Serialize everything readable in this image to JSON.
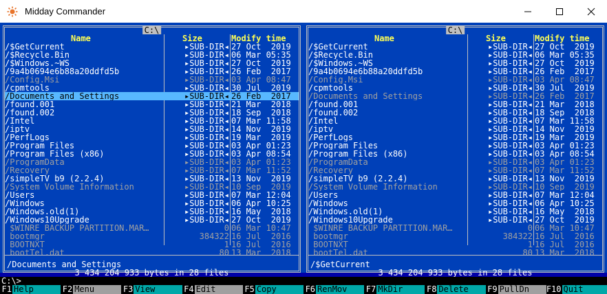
{
  "window": {
    "title": "Midday Commander"
  },
  "headers": {
    "name": "Name",
    "size": "Size",
    "modify": "Modify time"
  },
  "left": {
    "path": "C:\\",
    "selected_index": 5,
    "footer_name": "/Documents and Settings",
    "total": "3 434 204 933 bytes in 28 files",
    "entries": [
      {
        "name": "/$GetCurrent",
        "size": "▸SUB-DIR◂",
        "date": "27 Oct  2019",
        "type": "dir"
      },
      {
        "name": "/$Recycle.Bin",
        "size": "▸SUB-DIR◂",
        "date": "06 Mar 05:35",
        "type": "dir"
      },
      {
        "name": "/$Windows.~WS",
        "size": "▸SUB-DIR◂",
        "date": "27 Oct  2019",
        "type": "dir"
      },
      {
        "name": "/9a4b0694e6b88a20ddfd5b",
        "size": "▸SUB-DIR◂",
        "date": "26 Feb  2017",
        "type": "dir"
      },
      {
        "name": "/Config.Msi",
        "size": "▸SUB-DIR◂",
        "date": "03 Apr 08:47",
        "type": "hidden"
      },
      {
        "name": "/cpmtools",
        "size": "▸SUB-DIR◂",
        "date": "30 Jul  2019",
        "type": "dir"
      },
      {
        "name": "/Documents and Settings",
        "size": "▸SUB-DIR◂",
        "date": "26 Feb  2017",
        "type": "dir"
      },
      {
        "name": "/found.001",
        "size": "▸SUB-DIR◂",
        "date": "21 Mar  2018",
        "type": "dir"
      },
      {
        "name": "/found.002",
        "size": "▸SUB-DIR◂",
        "date": "18 Sep  2018",
        "type": "dir"
      },
      {
        "name": "/Intel",
        "size": "▸SUB-DIR◂",
        "date": "07 Mar 11:58",
        "type": "dir"
      },
      {
        "name": "/iptv",
        "size": "▸SUB-DIR◂",
        "date": "14 Nov  2019",
        "type": "dir"
      },
      {
        "name": "/PerfLogs",
        "size": "▸SUB-DIR◂",
        "date": "19 Mar  2019",
        "type": "dir"
      },
      {
        "name": "/Program Files",
        "size": "▸SUB-DIR◂",
        "date": "03 Apr 01:23",
        "type": "dir"
      },
      {
        "name": "/Program Files (x86)",
        "size": "▸SUB-DIR◂",
        "date": "03 Apr 08:54",
        "type": "dir"
      },
      {
        "name": "/ProgramData",
        "size": "▸SUB-DIR◂",
        "date": "03 Apr 01:23",
        "type": "hidden"
      },
      {
        "name": "/Recovery",
        "size": "▸SUB-DIR◂",
        "date": "07 Mar 11:52",
        "type": "hidden"
      },
      {
        "name": "/simpleTV b9 (2.2.4)",
        "size": "▸SUB-DIR◂",
        "date": "13 Nov  2019",
        "type": "dir"
      },
      {
        "name": "/System Volume Information",
        "size": "▸SUB-DIR◂",
        "date": "10 Sep  2019",
        "type": "hidden"
      },
      {
        "name": "/Users",
        "size": "▸SUB-DIR◂",
        "date": "07 Mar 12:04",
        "type": "dir"
      },
      {
        "name": "/Windows",
        "size": "▸SUB-DIR◂",
        "date": "06 Apr 10:25",
        "type": "dir"
      },
      {
        "name": "/Windows.old(1)",
        "size": "▸SUB-DIR◂",
        "date": "16 May  2018",
        "type": "dir"
      },
      {
        "name": "/Windows10Upgrade",
        "size": "▸SUB-DIR◂",
        "date": "27 Oct  2019",
        "type": "dir"
      },
      {
        "name": " $WINRE_BACKUP_PARTITION.MAR…",
        "size": "0",
        "date": "06 Mar 10:47",
        "type": "file"
      },
      {
        "name": " bootmgr",
        "size": "384322",
        "date": "16 Jul  2016",
        "type": "file"
      },
      {
        "name": " BOOTNXT",
        "size": "1",
        "date": "16 Jul  2016",
        "type": "file"
      },
      {
        "name": " bootTel.dat",
        "size": "80",
        "date": "13 Mar  2018",
        "type": "file"
      }
    ]
  },
  "right": {
    "path": "C:\\",
    "selected_index": -1,
    "footer_name": "/$GetCurrent",
    "total": "3 434 204 933 bytes in 28 files",
    "entries": [
      {
        "name": "/$GetCurrent",
        "size": "▸SUB-DIR◂",
        "date": "27 Oct  2019",
        "type": "dir"
      },
      {
        "name": "/$Recycle.Bin",
        "size": "▸SUB-DIR◂",
        "date": "06 Mar 05:35",
        "type": "dir"
      },
      {
        "name": "/$Windows.~WS",
        "size": "▸SUB-DIR◂",
        "date": "27 Oct  2019",
        "type": "dir"
      },
      {
        "name": "/9a4b0694e6b88a20ddfd5b",
        "size": "▸SUB-DIR◂",
        "date": "26 Feb  2017",
        "type": "dir"
      },
      {
        "name": "/Config.Msi",
        "size": "▸SUB-DIR◂",
        "date": "03 Apr 08:47",
        "type": "hidden"
      },
      {
        "name": "/cpmtools",
        "size": "▸SUB-DIR◂",
        "date": "30 Jul  2019",
        "type": "dir"
      },
      {
        "name": "/Documents and Settings",
        "size": "▸SUB-DIR◂",
        "date": "26 Feb  2017",
        "type": "hidden"
      },
      {
        "name": "/found.001",
        "size": "▸SUB-DIR◂",
        "date": "21 Mar  2018",
        "type": "dir"
      },
      {
        "name": "/found.002",
        "size": "▸SUB-DIR◂",
        "date": "18 Sep  2018",
        "type": "dir"
      },
      {
        "name": "/Intel",
        "size": "▸SUB-DIR◂",
        "date": "07 Mar 11:58",
        "type": "dir"
      },
      {
        "name": "/iptv",
        "size": "▸SUB-DIR◂",
        "date": "14 Nov  2019",
        "type": "dir"
      },
      {
        "name": "/PerfLogs",
        "size": "▸SUB-DIR◂",
        "date": "19 Mar  2019",
        "type": "dir"
      },
      {
        "name": "/Program Files",
        "size": "▸SUB-DIR◂",
        "date": "03 Apr 01:23",
        "type": "dir"
      },
      {
        "name": "/Program Files (x86)",
        "size": "▸SUB-DIR◂",
        "date": "03 Apr 08:54",
        "type": "dir"
      },
      {
        "name": "/ProgramData",
        "size": "▸SUB-DIR◂",
        "date": "03 Apr 01:23",
        "type": "hidden"
      },
      {
        "name": "/Recovery",
        "size": "▸SUB-DIR◂",
        "date": "07 Mar 11:52",
        "type": "hidden"
      },
      {
        "name": "/simpleTV b9 (2.2.4)",
        "size": "▸SUB-DIR◂",
        "date": "13 Nov  2019",
        "type": "dir"
      },
      {
        "name": "/System Volume Information",
        "size": "▸SUB-DIR◂",
        "date": "10 Sep  2019",
        "type": "hidden"
      },
      {
        "name": "/Users",
        "size": "▸SUB-DIR◂",
        "date": "07 Mar 12:04",
        "type": "dir"
      },
      {
        "name": "/Windows",
        "size": "▸SUB-DIR◂",
        "date": "06 Apr 10:25",
        "type": "dir"
      },
      {
        "name": "/Windows.old(1)",
        "size": "▸SUB-DIR◂",
        "date": "16 May  2018",
        "type": "dir"
      },
      {
        "name": "/Windows10Upgrade",
        "size": "▸SUB-DIR◂",
        "date": "27 Oct  2019",
        "type": "dir"
      },
      {
        "name": " $WINRE_BACKUP_PARTITION.MAR…",
        "size": "0",
        "date": "06 Mar 10:47",
        "type": "file"
      },
      {
        "name": " bootmgr",
        "size": "384322",
        "date": "16 Jul  2016",
        "type": "file"
      },
      {
        "name": " BOOTNXT",
        "size": "1",
        "date": "16 Jul  2016",
        "type": "file"
      },
      {
        "name": " bootTel.dat",
        "size": "80",
        "date": "13 Mar  2018",
        "type": "file"
      }
    ]
  },
  "cmdline": {
    "prompt": "C:\\>"
  },
  "keys": [
    {
      "num": "F1",
      "label": "Help"
    },
    {
      "num": "F2",
      "label": "Menu"
    },
    {
      "num": "F3",
      "label": "View"
    },
    {
      "num": "F4",
      "label": "Edit"
    },
    {
      "num": "F5",
      "label": "Copy"
    },
    {
      "num": "F6",
      "label": "RenMov"
    },
    {
      "num": "F7",
      "label": "MkDir"
    },
    {
      "num": "F8",
      "label": "Delete"
    },
    {
      "num": "F9",
      "label": "PullDn"
    },
    {
      "num": "F10",
      "label": "Quit"
    }
  ],
  "colors": {
    "panel_bg": "#0040b8",
    "header": "#ffff54",
    "selection": "#58b8ff",
    "key_label": "#00a8a8"
  }
}
